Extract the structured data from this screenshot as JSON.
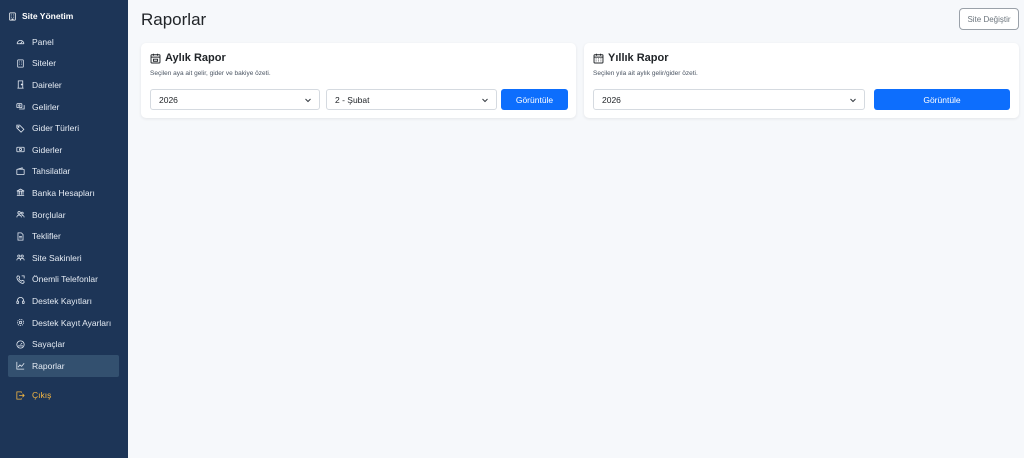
{
  "brand": {
    "title": "Site Yönetim",
    "icon": "building-icon"
  },
  "sidebar": {
    "items": [
      {
        "label": "Panel",
        "icon": "speedometer-icon"
      },
      {
        "label": "Siteler",
        "icon": "buildings-icon"
      },
      {
        "label": "Daireler",
        "icon": "door-icon"
      },
      {
        "label": "Gelirler",
        "icon": "income-icon"
      },
      {
        "label": "Gider Türleri",
        "icon": "tag-icon"
      },
      {
        "label": "Giderler",
        "icon": "cash-icon"
      },
      {
        "label": "Tahsilatlar",
        "icon": "wallet-icon"
      },
      {
        "label": "Banka Hesapları",
        "icon": "bank-icon"
      },
      {
        "label": "Borçlular",
        "icon": "people-icon"
      },
      {
        "label": "Teklifler",
        "icon": "document-icon"
      },
      {
        "label": "Site Sakinleri",
        "icon": "residents-icon"
      },
      {
        "label": "Önemli Telefonlar",
        "icon": "phone-icon"
      },
      {
        "label": "Destek Kayıtları",
        "icon": "headset-icon"
      },
      {
        "label": "Destek Kayıt Ayarları",
        "icon": "gear-icon"
      },
      {
        "label": "Sayaçlar",
        "icon": "gauge-icon"
      },
      {
        "label": "Raporlar",
        "icon": "chart-icon",
        "active": true
      }
    ],
    "exit_label": "Çıkış"
  },
  "header": {
    "title": "Raporlar",
    "switch_label": "Site Değiştir"
  },
  "monthly": {
    "title": "Aylık Rapor",
    "desc": "Seçilen aya ait gelir, gider ve bakiye özeti.",
    "year": "2026",
    "month": "2 - Şubat",
    "button": "Görüntüle"
  },
  "yearly": {
    "title": "Yıllık Rapor",
    "desc": "Seçilen yıla ait aylık gelir/gider özeti.",
    "year": "2026",
    "button": "Görüntüle"
  },
  "colors": {
    "sidebar": "#1d3557",
    "active": "#33506f",
    "primary": "#0d6efd",
    "exit": "#f4b642"
  }
}
